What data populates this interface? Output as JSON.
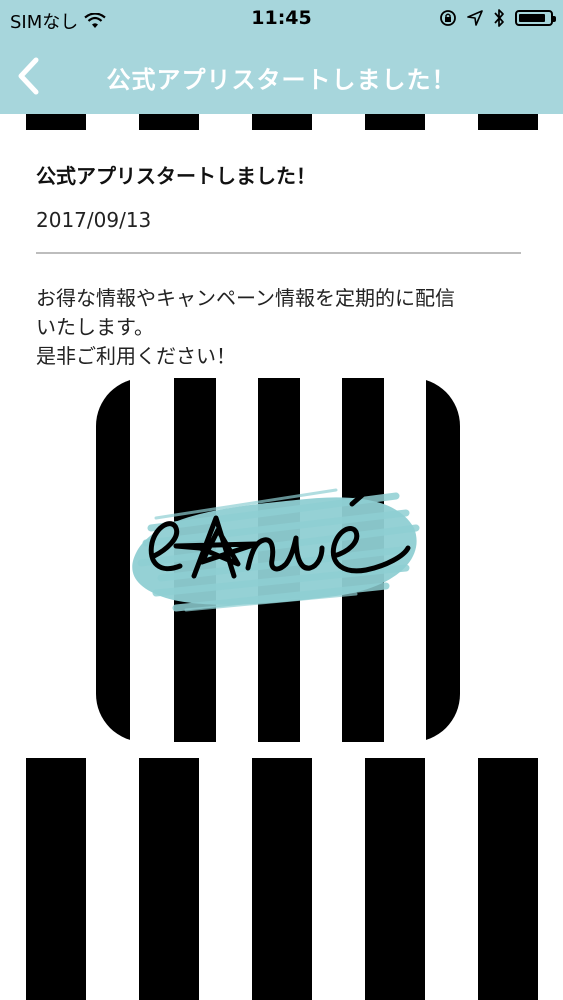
{
  "status_bar": {
    "carrier": "SIMなし",
    "time": "11:45",
    "battery_level": 0.85,
    "icons": [
      "wifi-icon",
      "orientation-lock-icon",
      "location-arrow-icon",
      "bluetooth-icon",
      "battery-icon"
    ]
  },
  "nav": {
    "title": "公式アプリスタートしました！",
    "back_icon": "chevron-left-icon"
  },
  "post": {
    "title": "公式アプリスタートしました！",
    "date": "2017/09/13",
    "body_lines": [
      "お得な情報やキャンペーン情報を定期的に配信",
      "いたします。",
      "是非ご利用ください！"
    ]
  },
  "logo": {
    "text": "eAné",
    "brush_color": "#8fcfd3",
    "stripe_color": "#000000"
  },
  "colors": {
    "header": "#a7d6dc",
    "header_text": "#ffffff",
    "stripe": "#000000"
  }
}
